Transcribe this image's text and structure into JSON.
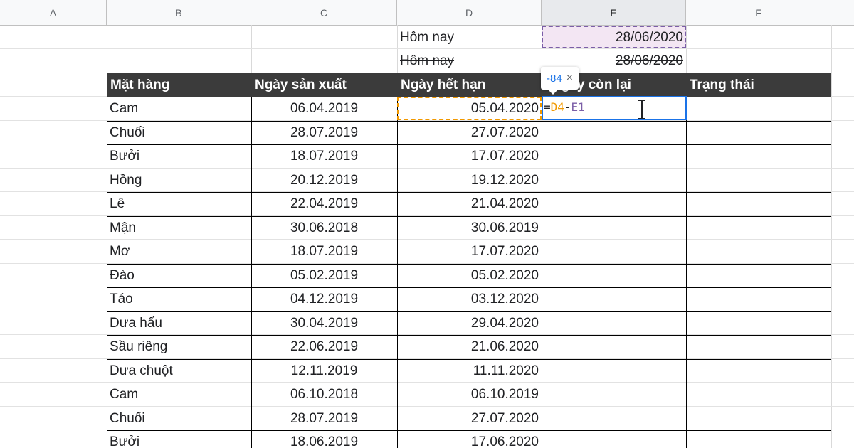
{
  "columns": [
    "A",
    "B",
    "C",
    "D",
    "E",
    "F"
  ],
  "top_rows": [
    {
      "label": "Hôm nay",
      "value": "28/06/2020",
      "strike": false
    },
    {
      "label": "Hôm nay",
      "value": "28/06/2020",
      "strike": true
    }
  ],
  "table_headers": [
    "Mặt hàng",
    "Ngày sản xuất",
    "Ngày hết hạn",
    "Ngày còn lại",
    "Trạng thái"
  ],
  "table_rows": [
    [
      "Cam",
      "06.04.2019",
      "05.04.2020"
    ],
    [
      "Chuối",
      "28.07.2019",
      "27.07.2020"
    ],
    [
      "Bưởi",
      "18.07.2019",
      "17.07.2020"
    ],
    [
      "Hồng",
      "20.12.2019",
      "19.12.2020"
    ],
    [
      "Lê",
      "22.04.2019",
      "21.04.2020"
    ],
    [
      "Mận",
      "30.06.2018",
      "30.06.2019"
    ],
    [
      "Mơ",
      "18.07.2019",
      "17.07.2020"
    ],
    [
      "Đào",
      "05.02.2019",
      "05.02.2020"
    ],
    [
      "Táo",
      "04.12.2019",
      "03.12.2020"
    ],
    [
      "Dưa hấu",
      "30.04.2019",
      "29.04.2020"
    ],
    [
      "Sầu riêng",
      "22.06.2019",
      "21.06.2020"
    ],
    [
      "Dưa chuột",
      "12.11.2019",
      "11.11.2020"
    ],
    [
      "Cam",
      "06.10.2018",
      "06.10.2019"
    ],
    [
      "Chuối",
      "28.07.2019",
      "27.07.2020"
    ],
    [
      "Bưởi",
      "18.06.2019",
      "17.06.2020"
    ]
  ],
  "formula": {
    "eq": "=",
    "ref1": "D4",
    "op": "-",
    "ref2": "E1"
  },
  "tooltip": {
    "value": "-84",
    "close": "×"
  },
  "colors": {
    "header_bg": "#3b3b3b",
    "ref_d4": "#f29900",
    "ref_e1": "#7b5ea7",
    "active_border": "#1a73e8"
  },
  "icons": {
    "cursor": "text-cursor-icon",
    "close": "close-icon"
  }
}
